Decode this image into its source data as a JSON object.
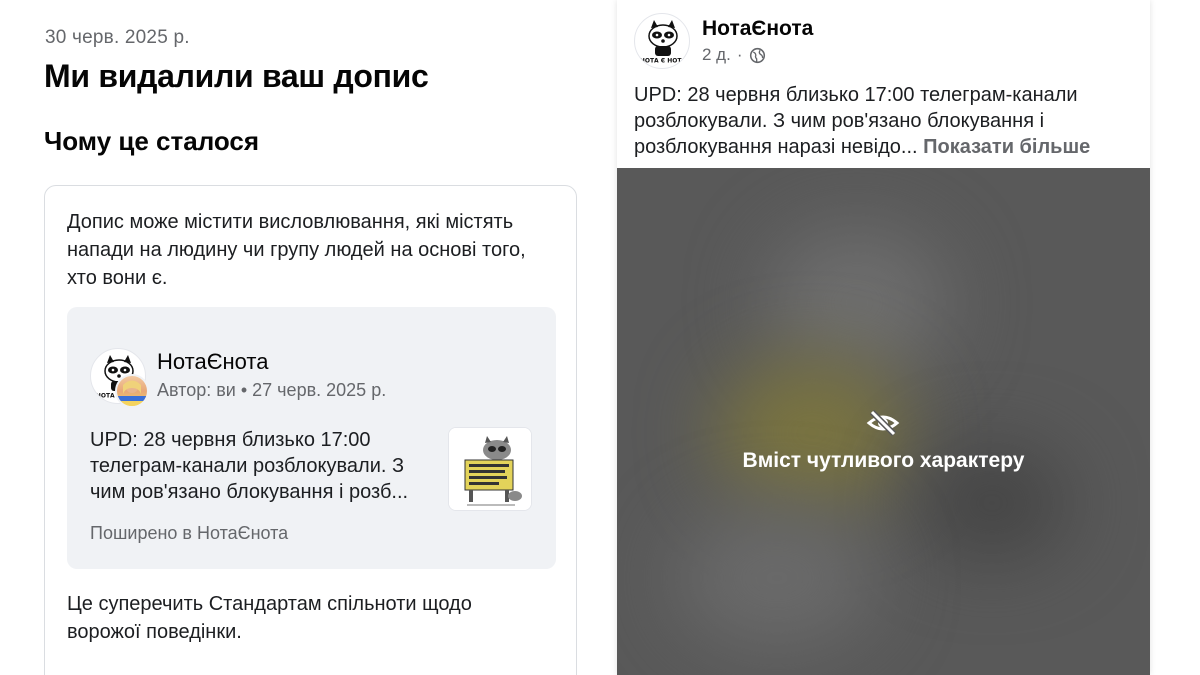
{
  "notice": {
    "date": "30 черв. 2025 р.",
    "title": "Ми видалили ваш допис",
    "subtitle": "Чому це сталося",
    "reason": "Допис може містити висловлювання, які містять напади на людину чи групу людей на основі того, хто вони є.",
    "violation": "Це суперечить Стандартам спільноти щодо ворожої поведінки."
  },
  "preview": {
    "page_name": "НотаЄнота",
    "meta": "Автор: ви • 27 черв. 2025 р.",
    "text": "UPD: 28 червня близько 17:00 телеграм-канали розблокували. З чим ров'язано блокування і розб...",
    "shared_in": "Поширено в НотаЄнота",
    "avatar_icon": "raccoon-logo-icon",
    "thumb_icon": "raccoon-sign-thumbnail-icon"
  },
  "post": {
    "page_name": "НотаЄнота",
    "age": "2 д.",
    "separator": "·",
    "privacy_icon": "globe-icon",
    "text": "UPD: 28 червня близько 17:00 телеграм-канали розблокували. З чим ров'язано блокування і розблокування наразі невідо...",
    "show_more": "Показати більше",
    "sensitive_label": "Вміст чутливого характеру",
    "sensitive_icon": "eye-slash-icon"
  },
  "colors": {
    "secondary_text": "#65676b",
    "overlay": "#595959",
    "preview_bg": "#f0f2f5"
  }
}
